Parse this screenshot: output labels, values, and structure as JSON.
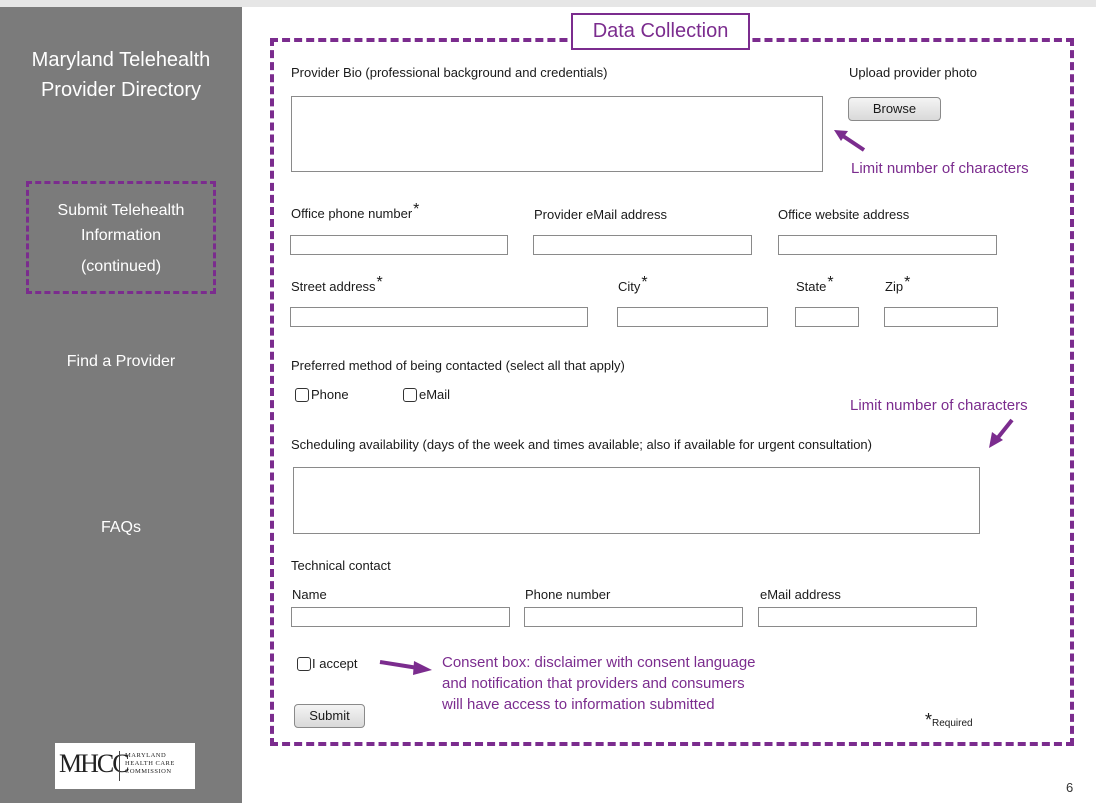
{
  "sidebar": {
    "title_line1": "Maryland Telehealth",
    "title_line2": "Provider Directory",
    "submit_line1": "Submit Telehealth",
    "submit_line2": "Information",
    "submit_line3": "(continued)",
    "find_provider": "Find a Provider",
    "faqs": "FAQs",
    "logo_mark": "MHCC",
    "logo_line1": "MARYLAND",
    "logo_line2": "HEALTH CARE",
    "logo_line3": "COMMISSION"
  },
  "section_title": "Data Collection",
  "form": {
    "bio_label": "Provider Bio (professional background and credentials)",
    "bio_value": "",
    "photo_label": "Upload provider photo",
    "browse_button": "Browse",
    "phone_label": "Office phone number",
    "phone_value": "",
    "email_label": "Provider eMail address",
    "email_value": "",
    "website_label": "Office website address",
    "website_value": "",
    "street_label": "Street address",
    "street_value": "",
    "city_label": "City",
    "city_value": "",
    "state_label": "State",
    "state_value": "",
    "zip_label": "Zip",
    "zip_value": "",
    "required_star": "*",
    "contact_method_label": "Preferred method of being contacted  (select all that apply)",
    "contact_phone": "Phone",
    "contact_email": "eMail",
    "scheduling_label": "Scheduling availability (days of the week and times available; also if available for urgent consultation)",
    "scheduling_value": "",
    "tech_contact_label": "Technical contact",
    "tech_name_label": "Name",
    "tech_name_value": "",
    "tech_phone_label": "Phone number",
    "tech_phone_value": "",
    "tech_email_label": "eMail address",
    "tech_email_value": "",
    "accept_label": "I accept",
    "submit_button": "Submit",
    "required_note": "Required"
  },
  "annotations": {
    "limit_chars_1": "Limit number of characters",
    "limit_chars_2": "Limit number of characters",
    "consent_line1": "Consent box: disclaimer with consent language",
    "consent_line2": "and notification that providers and consumers",
    "consent_line3": "will have access to information submitted"
  },
  "page_number": "6",
  "colors": {
    "accent": "#7b2c8e",
    "sidebar": "#7b7b7b"
  }
}
